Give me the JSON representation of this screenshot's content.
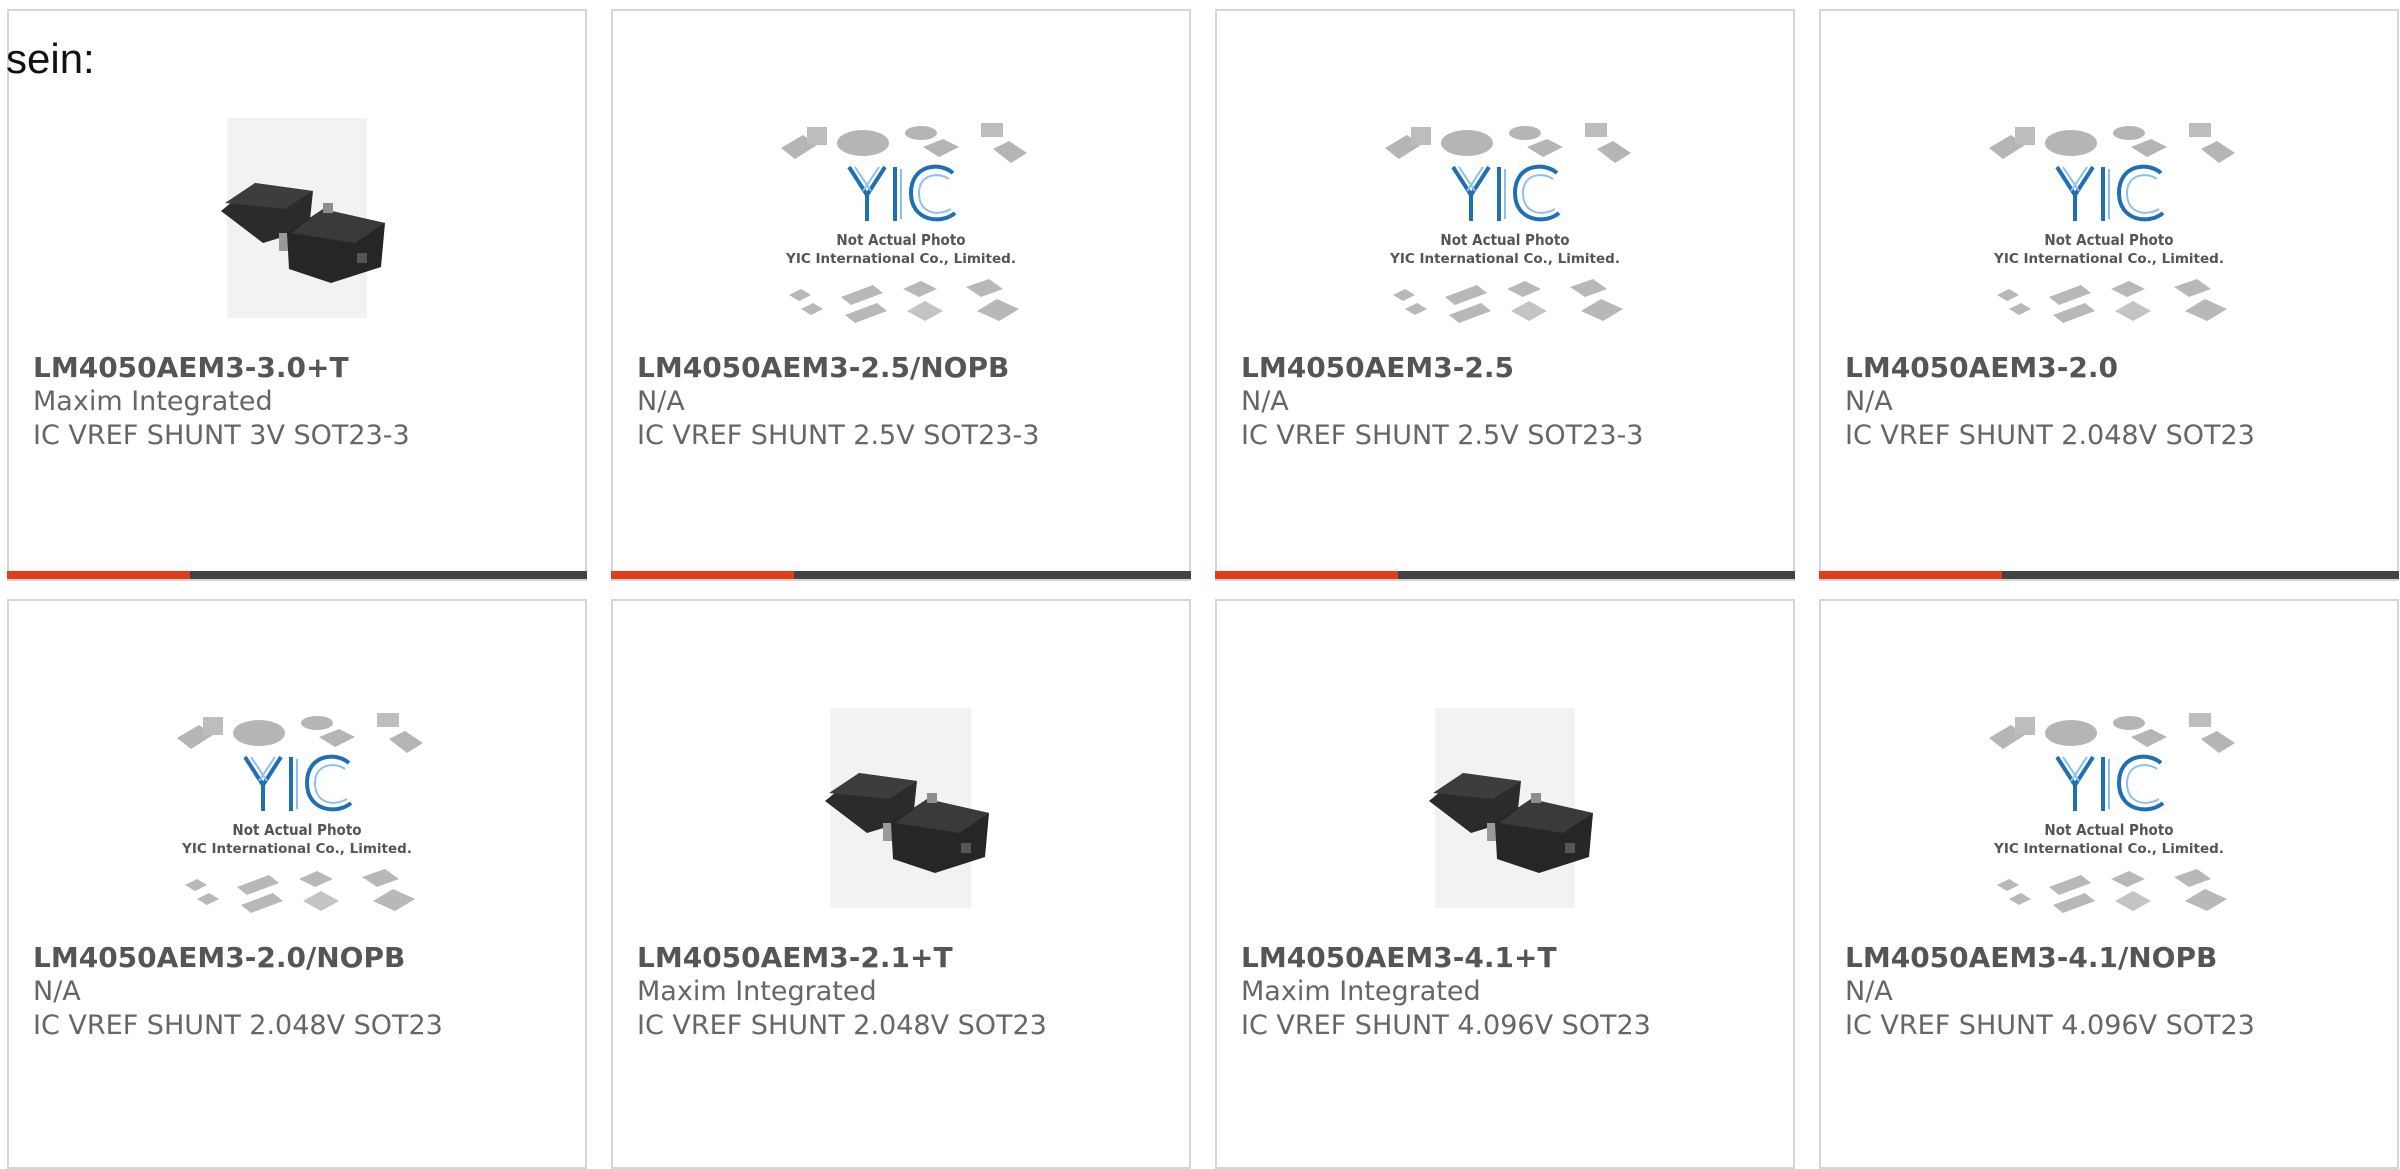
{
  "page": {
    "label": "sein:"
  },
  "products": [
    {
      "part_number": "LM4050AEM3-3.0+T",
      "manufacturer": "Maxim Integrated",
      "description": "IC VREF SHUNT 3V SOT23-3",
      "image": "sot23-package-photo",
      "accent_bar": true
    },
    {
      "part_number": "LM4050AEM3-2.5/NOPB",
      "manufacturer": "N/A",
      "description": "IC VREF SHUNT 2.5V SOT23-3",
      "image": "yic-not-actual-photo",
      "accent_bar": true
    },
    {
      "part_number": "LM4050AEM3-2.5",
      "manufacturer": "N/A",
      "description": "IC VREF SHUNT 2.5V SOT23-3",
      "image": "yic-not-actual-photo",
      "accent_bar": true
    },
    {
      "part_number": "LM4050AEM3-2.0",
      "manufacturer": "N/A",
      "description": "IC VREF SHUNT 2.048V SOT23",
      "image": "yic-not-actual-photo",
      "accent_bar": true
    },
    {
      "part_number": "LM4050AEM3-2.0/NOPB",
      "manufacturer": "N/A",
      "description": "IC VREF SHUNT 2.048V SOT23",
      "image": "yic-not-actual-photo",
      "accent_bar": false
    },
    {
      "part_number": "LM4050AEM3-2.1+T",
      "manufacturer": "Maxim Integrated",
      "description": "IC VREF SHUNT 2.048V SOT23",
      "image": "sot23-package-photo",
      "accent_bar": false
    },
    {
      "part_number": "LM4050AEM3-4.1+T",
      "manufacturer": "Maxim Integrated",
      "description": "IC VREF SHUNT 4.096V SOT23",
      "image": "sot23-package-photo",
      "accent_bar": false
    },
    {
      "part_number": "LM4050AEM3-4.1/NOPB",
      "manufacturer": "N/A",
      "description": "IC VREF SHUNT 4.096V SOT23",
      "image": "yic-not-actual-photo",
      "accent_bar": false
    }
  ],
  "placeholder_image": {
    "logo_text": "YIC",
    "line1": "Not Actual Photo",
    "line2": "YIC International Co., Limited."
  },
  "colors": {
    "accent": "#e33d1a",
    "bar_dark": "#444444",
    "card_border": "#d6d6d6",
    "part_number_text": "#555555",
    "logo_blue": "#1f6fb5"
  }
}
